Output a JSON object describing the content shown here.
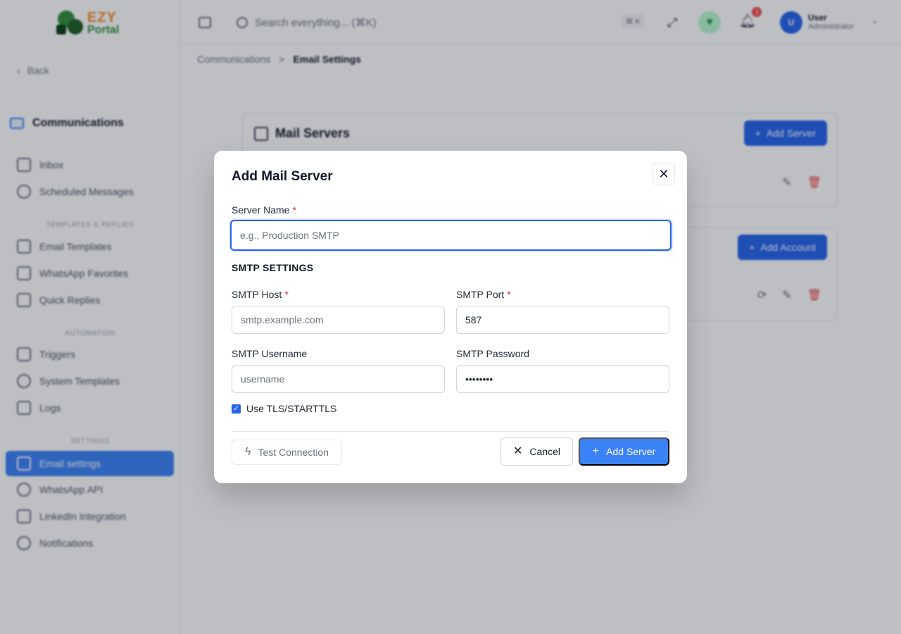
{
  "brand": {
    "logo_line1": "EZY",
    "logo_line2": "Portal"
  },
  "sidebar": {
    "back_label": "Back",
    "section_title": "Communications",
    "items": [
      {
        "label": "Inbox"
      },
      {
        "label": "Scheduled Messages"
      },
      {
        "label": "Email Templates"
      },
      {
        "label": "WhatsApp Favorites"
      },
      {
        "label": "Quick Replies"
      },
      {
        "label": "Triggers"
      },
      {
        "label": "System Templates"
      },
      {
        "label": "Logs"
      },
      {
        "label": "Email settings"
      },
      {
        "label": "WhatsApp API"
      },
      {
        "label": "LinkedIn Integration"
      },
      {
        "label": "Notifications"
      }
    ],
    "groups": {
      "templates": "TEMPLATES & REPLIES",
      "automation": "AUTOMATION",
      "settings": "SETTINGS"
    },
    "active_item": "Email settings"
  },
  "topbar": {
    "search_placeholder": "Search everything... (⌘K)",
    "search_shortcut": "⌘ K",
    "notification_count": "3",
    "user_initial": "U",
    "user_name": "User",
    "user_role": "Administrator"
  },
  "breadcrumb": {
    "parent": "Communications",
    "separator": ">",
    "current": "Email Settings"
  },
  "page": {
    "mail_servers_title": "Mail Servers",
    "add_server_btn": "Add Server",
    "add_account_btn": "Add Account"
  },
  "modal": {
    "title": "Add Mail Server",
    "server_name_label": "Server Name",
    "server_name_placeholder": "e.g., Production SMTP",
    "smtp_section": "SMTP SETTINGS",
    "smtp_host_label": "SMTP Host",
    "smtp_host_placeholder": "smtp.example.com",
    "smtp_port_label": "SMTP Port",
    "smtp_port_value": "587",
    "smtp_username_label": "SMTP Username",
    "smtp_username_placeholder": "username",
    "smtp_password_label": "SMTP Password",
    "smtp_password_value": "••••••••",
    "tls_label": "Use TLS/STARTTLS",
    "tls_checked": true,
    "required_marker": "*",
    "test_button": "Test Connection",
    "cancel_button": "Cancel",
    "add_button": "Add Server"
  },
  "colors": {
    "primary": "#3b82f6",
    "danger": "#dc2626"
  }
}
